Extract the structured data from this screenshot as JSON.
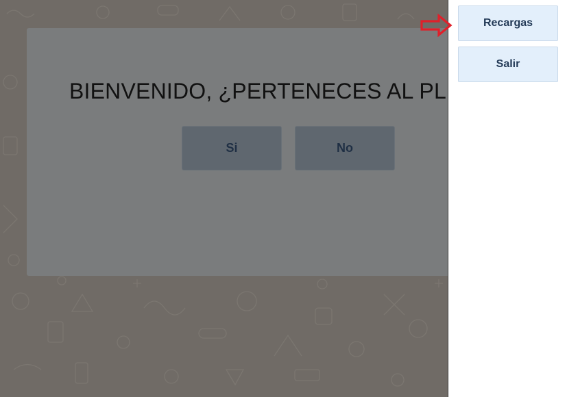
{
  "dialog": {
    "title": "BIENVENIDO, ¿PERTENECES AL PL",
    "yes_label": "Si",
    "no_label": "No"
  },
  "drawer": {
    "items": [
      {
        "label": "Recargas"
      },
      {
        "label": "Salir"
      }
    ]
  },
  "annotation": {
    "arrow_color": "#e0202a",
    "icon": "right-arrow-icon"
  },
  "colors": {
    "overlay_bg": "#706b66",
    "dialog_bg": "#7a7c7d",
    "drawer_button_bg": "#e3effb",
    "drawer_button_text": "#233a57"
  }
}
